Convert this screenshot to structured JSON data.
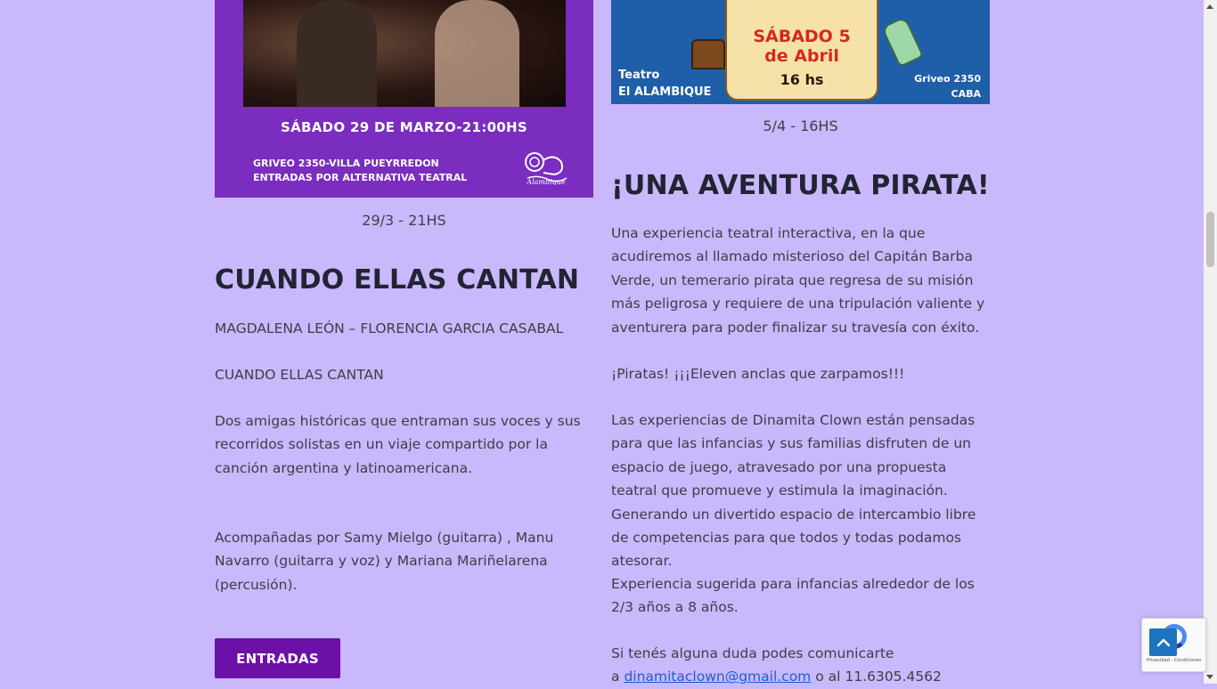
{
  "event_left": {
    "poster": {
      "date_line": "SÁBADO 29 DE MARZO-21:00HS",
      "address_line1": "GRIVEO 2350-VILLA PUEYRREDON",
      "address_line2": "ENTRADAS POR ALTERNATIVA TEATRAL",
      "logo_text": "Alambique"
    },
    "caption": "29/3 - 21HS",
    "title": "CUANDO ELLAS CANTAN",
    "performers": "MAGDALENA LEÓN – FLORENCIA GARCIA CASABAL",
    "subtitle": "CUANDO ELLAS CANTAN",
    "description": "Dos amigas históricas que entraman sus voces y sus recorridos solistas en un viaje compartido por la canción argentina y latinoamericana.",
    "accompaniment_line1": "Acompañadas por Samy Mielgo (guitarra) , Manu Navarro (guitarra y voz) y Mariana Mariñelarena",
    "accompaniment_line2": "(percusión).",
    "button_label": "ENTRADAS"
  },
  "event_right": {
    "poster": {
      "scroll_line1": "SÁBADO 5",
      "scroll_line2": "de Abril",
      "scroll_time": "16 hs",
      "venue_line1": "Teatro",
      "venue_line2": "El ALAMBIQUE",
      "place_line1": "Griveo 2350",
      "place_line2": "CABA"
    },
    "caption": "5/4 - 16HS",
    "title": "¡UNA AVENTURA PIRATA!",
    "paragraph1": "Una experiencia teatral interactiva, en la que acudiremos al llamado misterioso del Capitán Barba Verde, un temerario pirata que regresa de su misión más peligrosa y requiere de una tripulación valiente y aventurera para poder finalizar su travesía con éxito.",
    "paragraph2": "¡Piratas! ¡¡¡Eleven anclas que zarpamos!!!",
    "paragraph3": "Las experiencias de Dinamita Clown están pensadas para que las infancias y sus familias disfruten de un espacio de juego, atravesado por una propuesta teatral que promueve y estimula la imaginación. Generando un divertido espacio de intercambio libre de competencias para que todos y todas podamos atesorar.",
    "paragraph4": "Experiencia sugerida para infancias alrededor de los 2/3 años a 8 años.",
    "contact_line1": "Si tenés alguna duda podes comunicarte",
    "contact_prefix": "a",
    "contact_email": "dinamitaclown@gmail.com",
    "contact_suffix": "o al 11.6305.4562"
  },
  "recaptcha": {
    "terms": "Privacidad - Condiciones"
  },
  "colors": {
    "page_background": "#c9b8fb",
    "button": "#6d10a8",
    "link": "#1a5fd6",
    "back_to_top": "#1e73be"
  },
  "icons": {
    "back_to_top": "chevron-up-icon",
    "recaptcha": "recaptcha-icon"
  }
}
